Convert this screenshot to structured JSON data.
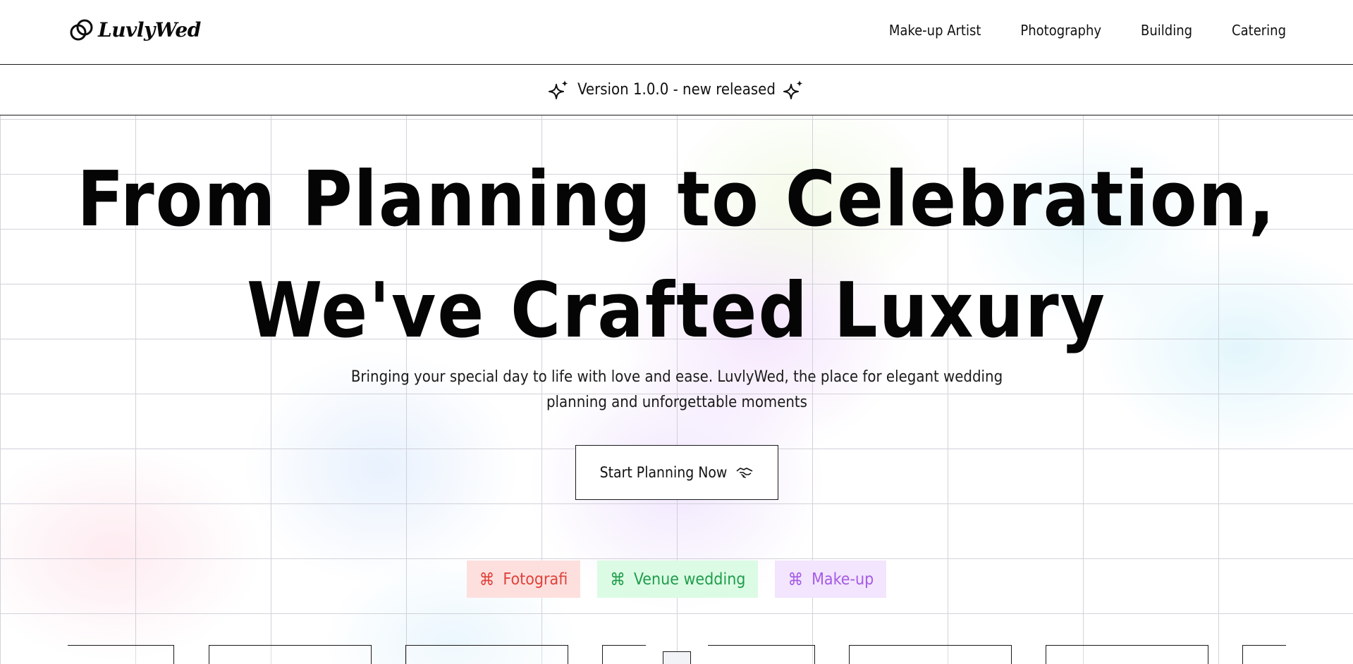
{
  "header": {
    "logo_text": "LuvlyWed",
    "nav": [
      "Make-up Artist",
      "Photography",
      "Building",
      "Catering"
    ]
  },
  "announcement": {
    "text": "Version 1.0.0 - new released",
    "icon": "sparkle-icon"
  },
  "hero": {
    "title_line1": "From Planning to Celebration,",
    "title_line2": "We've Crafted Luxury",
    "subtitle_line1": "Bringing your special day to life with love and ease. LuvlyWed, the place for elegant wedding",
    "subtitle_line2": "planning and unforgettable moments",
    "cta_label": "Start Planning Now",
    "cta_icon": "handshake-icon",
    "tags": [
      {
        "label": "Fotografi",
        "icon": "command-icon",
        "color": "#e0413a",
        "bg": "#fde0de"
      },
      {
        "label": "Venue wedding",
        "icon": "command-icon",
        "color": "#1f9d4c",
        "bg": "#dcfbe4"
      },
      {
        "label": "Make-up",
        "icon": "command-icon",
        "color": "#a55be6",
        "bg": "#f2e5fd"
      }
    ]
  }
}
